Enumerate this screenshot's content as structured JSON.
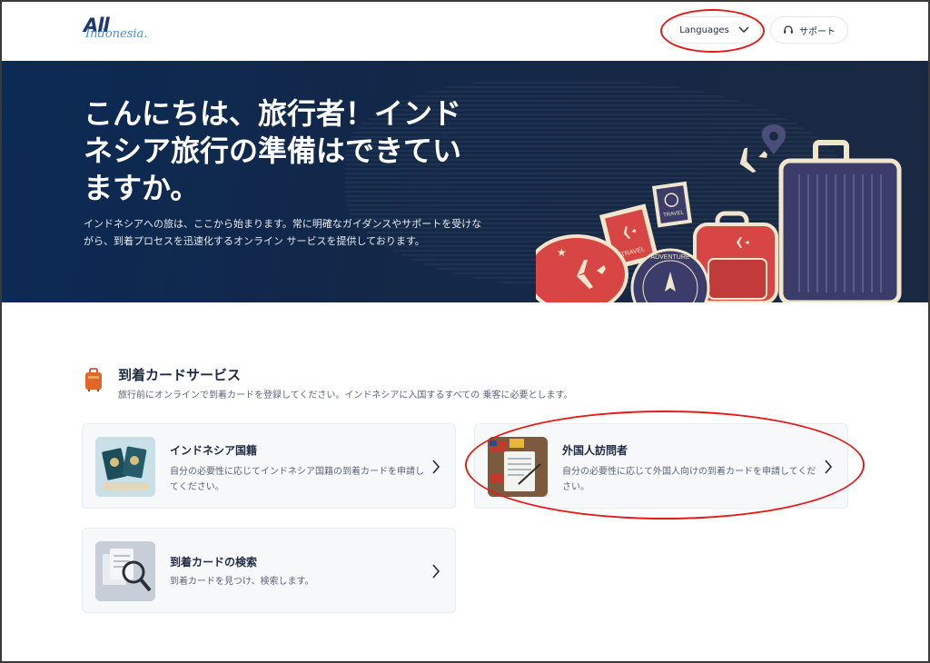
{
  "header": {
    "logo_main": "All",
    "logo_sub": "Indonesia.",
    "languages_label": "Languages",
    "support_label": "サポート"
  },
  "hero": {
    "title": "こんにちは、旅行者！インドネシア旅行の準備はできていますか。",
    "description": "インドネシアへの旅は、ここから始まります。常に明確なガイダンスやサポートを受けながら、到着プロセスを迅速化するオンライン サービスを提供しております。",
    "stamp_travel_1": "TRAVEL",
    "stamp_travel_2": "TRAVEL",
    "badge_adventure": "ADVENTURE"
  },
  "section": {
    "title": "到着カードサービス",
    "subtitle": "旅行前にオンラインで到着カードを登録してください。インドネシアに入国するすべての 乗客に必要とします。"
  },
  "cards": [
    {
      "title": "インドネシア国籍",
      "description": "自分の必要性に応じてインドネシア国籍の到着カードを申請してください。"
    },
    {
      "title": "外国人訪問者",
      "description": "自分の必要性に応じて外国人向けの到着カードを申請してください。"
    },
    {
      "title": "到着カードの検索",
      "description": "到着カードを見つけ、検索します。"
    }
  ],
  "icons": {
    "chevron": "chevron-right-icon",
    "dropdown": "chevron-down-icon",
    "support": "headset-icon",
    "section": "suitcase-icon"
  },
  "colors": {
    "hero_bg": "#132849",
    "annotation": "#e21b1b",
    "text_dark": "#1f2a44",
    "card_bg": "#f7f8fa"
  }
}
